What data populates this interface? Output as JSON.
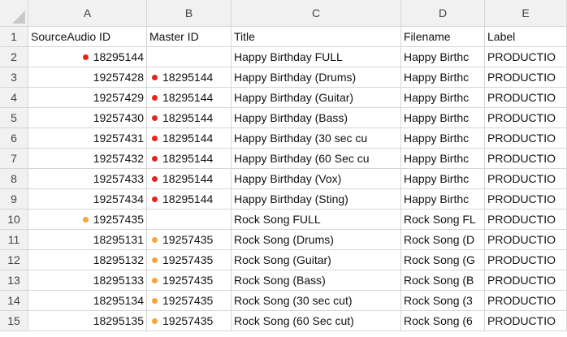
{
  "columns": [
    "A",
    "B",
    "C",
    "D",
    "E"
  ],
  "colors": {
    "red": "#e8231f",
    "orange": "#f5a53a"
  },
  "rows": [
    {
      "num": "1",
      "a": "SourceAudio ID",
      "b": "Master ID",
      "c": "Title",
      "d": "Filename",
      "e": "Label",
      "dot_a": "",
      "dot_b": "",
      "header": true
    },
    {
      "num": "2",
      "a": "18295144",
      "b": "",
      "c": "Happy Birthday FULL",
      "d": "Happy Birthc",
      "e": "PRODUCTIO",
      "dot_a": "red",
      "dot_b": ""
    },
    {
      "num": "3",
      "a": "19257428",
      "b": "18295144",
      "c": "Happy Birthday (Drums)",
      "d": "Happy Birthc",
      "e": "PRODUCTIO",
      "dot_a": "",
      "dot_b": "red"
    },
    {
      "num": "4",
      "a": "19257429",
      "b": "18295144",
      "c": "Happy Birthday (Guitar)",
      "d": "Happy Birthc",
      "e": "PRODUCTIO",
      "dot_a": "",
      "dot_b": "red"
    },
    {
      "num": "5",
      "a": "19257430",
      "b": "18295144",
      "c": "Happy Birthday (Bass)",
      "d": "Happy Birthc",
      "e": "PRODUCTIO",
      "dot_a": "",
      "dot_b": "red"
    },
    {
      "num": "6",
      "a": "19257431",
      "b": "18295144",
      "c": "Happy Birthday (30 sec cu",
      "d": "Happy Birthc",
      "e": "PRODUCTIO",
      "dot_a": "",
      "dot_b": "red"
    },
    {
      "num": "7",
      "a": "19257432",
      "b": "18295144",
      "c": "Happy Birthday (60 Sec cu",
      "d": "Happy Birthc",
      "e": "PRODUCTIO",
      "dot_a": "",
      "dot_b": "red"
    },
    {
      "num": "8",
      "a": "19257433",
      "b": "18295144",
      "c": "Happy Birthday (Vox)",
      "d": "Happy Birthc",
      "e": "PRODUCTIO",
      "dot_a": "",
      "dot_b": "red"
    },
    {
      "num": "9",
      "a": "19257434",
      "b": "18295144",
      "c": "Happy Birthday (Sting)",
      "d": "Happy Birthc",
      "e": "PRODUCTIO",
      "dot_a": "",
      "dot_b": "red"
    },
    {
      "num": "10",
      "a": "19257435",
      "b": "",
      "c": "Rock Song FULL",
      "d": "Rock Song FL",
      "e": "PRODUCTIO",
      "dot_a": "orange",
      "dot_b": ""
    },
    {
      "num": "11",
      "a": "18295131",
      "b": "19257435",
      "c": "Rock Song (Drums)",
      "d": "Rock Song (D",
      "e": "PRODUCTIO",
      "dot_a": "",
      "dot_b": "orange"
    },
    {
      "num": "12",
      "a": "18295132",
      "b": "19257435",
      "c": "Rock Song (Guitar)",
      "d": "Rock Song (G",
      "e": "PRODUCTIO",
      "dot_a": "",
      "dot_b": "orange"
    },
    {
      "num": "13",
      "a": "18295133",
      "b": "19257435",
      "c": "Rock Song (Bass)",
      "d": "Rock Song (B",
      "e": "PRODUCTIO",
      "dot_a": "",
      "dot_b": "orange"
    },
    {
      "num": "14",
      "a": "18295134",
      "b": "19257435",
      "c": "Rock Song (30 sec cut)",
      "d": "Rock Song (3",
      "e": "PRODUCTIO",
      "dot_a": "",
      "dot_b": "orange"
    },
    {
      "num": "15",
      "a": "18295135",
      "b": "19257435",
      "c": "Rock Song (60 Sec cut)",
      "d": "Rock Song (6",
      "e": "PRODUCTIO",
      "dot_a": "",
      "dot_b": "orange"
    }
  ]
}
